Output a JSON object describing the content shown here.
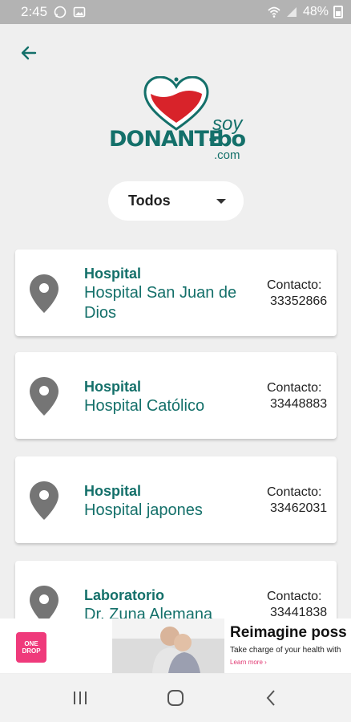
{
  "status_bar": {
    "time": "2:45",
    "battery": "48%"
  },
  "logo": {
    "word": "DONANTE",
    "soy": "soy",
    "bo": "-bo",
    "com": ".com"
  },
  "filter": {
    "selected": "Todos"
  },
  "cards": [
    {
      "type": "Hospital",
      "name": "Hospital San Juan de Dios",
      "contact_label": "Contacto:",
      "phone": "33352866"
    },
    {
      "type": "Hospital",
      "name": "Hospital Católico",
      "contact_label": "Contacto:",
      "phone": "33448883"
    },
    {
      "type": "Hospital",
      "name": "Hospital japones",
      "contact_label": "Contacto:",
      "phone": "33462031"
    },
    {
      "type": "Laboratorio",
      "name": "Dr. Zuna Alemana",
      "contact_label": "Contacto:",
      "phone": "33441838"
    }
  ],
  "ad": {
    "logo_line1": "ONE",
    "logo_line2": "DROP",
    "title": "Reimagine poss",
    "subtitle": "Take charge of your health with",
    "link": "Learn more ›"
  },
  "colors": {
    "brand": "#14706a",
    "heart": "#d8232a",
    "ad_accent": "#ef3a7b"
  },
  "icons": {
    "back": "arrow-left-icon",
    "pin": "location-pin-icon",
    "nav": [
      "recent-apps-icon",
      "home-icon",
      "back-nav-icon"
    ]
  }
}
